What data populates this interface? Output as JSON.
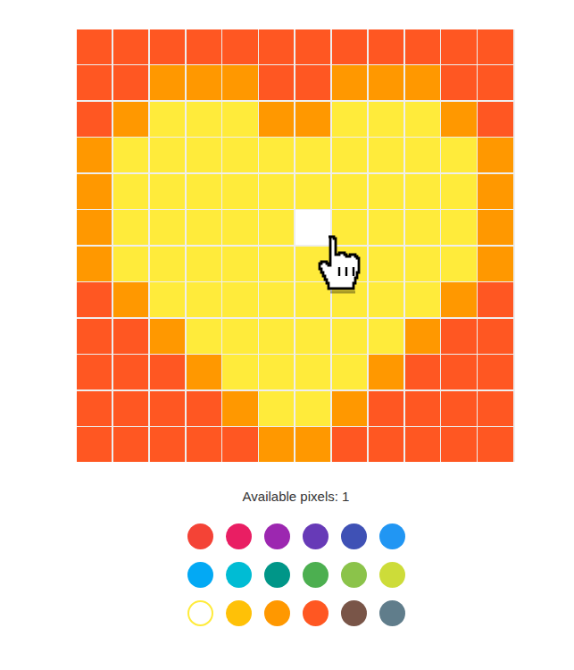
{
  "board": {
    "rows": [
      [
        "#ff5722",
        "#ff5722",
        "#ff5722",
        "#ff5722",
        "#ff5722",
        "#ff5722",
        "#ff5722",
        "#ff5722",
        "#ff5722",
        "#ff5722",
        "#ff5722",
        "#ff5722"
      ],
      [
        "#ff5722",
        "#ff5722",
        "#ff9800",
        "#ff9800",
        "#ff9800",
        "#ff5722",
        "#ff5722",
        "#ff9800",
        "#ff9800",
        "#ff9800",
        "#ff5722",
        "#ff5722"
      ],
      [
        "#ff5722",
        "#ff9800",
        "#ffeb3b",
        "#ffeb3b",
        "#ffeb3b",
        "#ff9800",
        "#ff9800",
        "#ffeb3b",
        "#ffeb3b",
        "#ffeb3b",
        "#ff9800",
        "#ff5722"
      ],
      [
        "#ff9800",
        "#ffeb3b",
        "#ffeb3b",
        "#ffeb3b",
        "#ffeb3b",
        "#ffeb3b",
        "#ffeb3b",
        "#ffeb3b",
        "#ffeb3b",
        "#ffeb3b",
        "#ffeb3b",
        "#ff9800"
      ],
      [
        "#ff9800",
        "#ffeb3b",
        "#ffeb3b",
        "#ffeb3b",
        "#ffeb3b",
        "#ffeb3b",
        "#ffeb3b",
        "#ffeb3b",
        "#ffeb3b",
        "#ffeb3b",
        "#ffeb3b",
        "#ff9800"
      ],
      [
        "#ff9800",
        "#ffeb3b",
        "#ffeb3b",
        "#ffeb3b",
        "#ffeb3b",
        "#ffeb3b",
        "#ffffff",
        "#ffeb3b",
        "#ffeb3b",
        "#ffeb3b",
        "#ffeb3b",
        "#ff9800"
      ],
      [
        "#ff9800",
        "#ffeb3b",
        "#ffeb3b",
        "#ffeb3b",
        "#ffeb3b",
        "#ffeb3b",
        "#ffeb3b",
        "#ffeb3b",
        "#ffeb3b",
        "#ffeb3b",
        "#ffeb3b",
        "#ff9800"
      ],
      [
        "#ff5722",
        "#ff9800",
        "#ffeb3b",
        "#ffeb3b",
        "#ffeb3b",
        "#ffeb3b",
        "#ffeb3b",
        "#ffeb3b",
        "#ffeb3b",
        "#ffeb3b",
        "#ff9800",
        "#ff5722"
      ],
      [
        "#ff5722",
        "#ff5722",
        "#ff9800",
        "#ffeb3b",
        "#ffeb3b",
        "#ffeb3b",
        "#ffeb3b",
        "#ffeb3b",
        "#ffeb3b",
        "#ff9800",
        "#ff5722",
        "#ff5722"
      ],
      [
        "#ff5722",
        "#ff5722",
        "#ff5722",
        "#ff9800",
        "#ffeb3b",
        "#ffeb3b",
        "#ffeb3b",
        "#ffeb3b",
        "#ff9800",
        "#ff5722",
        "#ff5722",
        "#ff5722"
      ],
      [
        "#ff5722",
        "#ff5722",
        "#ff5722",
        "#ff5722",
        "#ff9800",
        "#ffeb3b",
        "#ffeb3b",
        "#ff9800",
        "#ff5722",
        "#ff5722",
        "#ff5722",
        "#ff5722"
      ],
      [
        "#ff5722",
        "#ff5722",
        "#ff5722",
        "#ff5722",
        "#ff5722",
        "#ff9800",
        "#ff9800",
        "#ff5722",
        "#ff5722",
        "#ff5722",
        "#ff5722",
        "#ff5722"
      ]
    ]
  },
  "available_pixels": "Available pixels: 1",
  "palette": [
    {
      "color": "#f44336",
      "selected": false
    },
    {
      "color": "#e91e63",
      "selected": false
    },
    {
      "color": "#9c27b0",
      "selected": false
    },
    {
      "color": "#673ab7",
      "selected": false
    },
    {
      "color": "#3f51b5",
      "selected": false
    },
    {
      "color": "#2196f3",
      "selected": false
    },
    {
      "color": "#03a9f4",
      "selected": false
    },
    {
      "color": "#00bcd4",
      "selected": false
    },
    {
      "color": "#009688",
      "selected": false
    },
    {
      "color": "#4caf50",
      "selected": false
    },
    {
      "color": "#8bc34a",
      "selected": false
    },
    {
      "color": "#cddc39",
      "selected": false
    },
    {
      "color": "#ffffff",
      "selected": true
    },
    {
      "color": "#ffc107",
      "selected": false
    },
    {
      "color": "#ff9800",
      "selected": false
    },
    {
      "color": "#ff5722",
      "selected": false
    },
    {
      "color": "#795548",
      "selected": false
    },
    {
      "color": "#607d8b",
      "selected": false
    }
  ]
}
